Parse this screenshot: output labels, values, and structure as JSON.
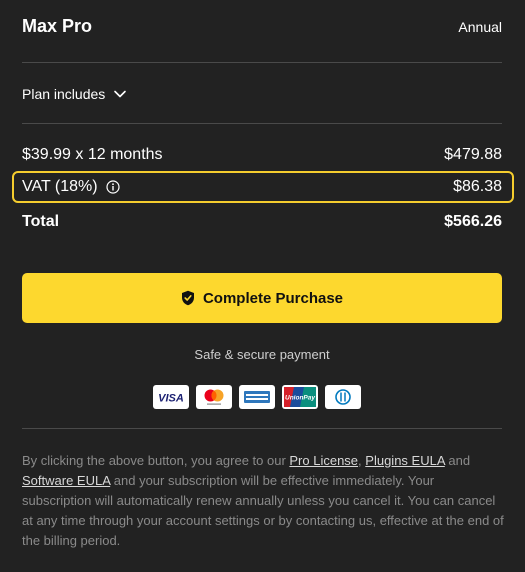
{
  "plan": {
    "name": "Max Pro",
    "billing_period": "Annual"
  },
  "plan_includes": {
    "label": "Plan includes"
  },
  "pricing": {
    "line_item_label": "$39.99 x 12 months",
    "line_item_value": "$479.88",
    "vat_label": "VAT (18%)",
    "vat_value": "$86.38",
    "total_label": "Total",
    "total_value": "$566.26"
  },
  "cta": {
    "label": "Complete Purchase"
  },
  "secure_text": "Safe & secure payment",
  "payment_methods": [
    {
      "name": "Visa",
      "label": "VISA",
      "color": "#1a1f71"
    },
    {
      "name": "Mastercard",
      "color": "#eb001b"
    },
    {
      "name": "American Express",
      "color": "#2e77bc"
    },
    {
      "name": "UnionPay",
      "label": "UnionPay",
      "color": "#d6202a"
    },
    {
      "name": "Diners Club",
      "color": "#0079be"
    }
  ],
  "legal": {
    "text_1": "By clicking the above button, you agree to our ",
    "link_pro_license": "Pro License",
    "text_2": ", ",
    "link_plugins_eula": "Plugins EULA",
    "text_3": " and ",
    "link_software_eula": "Software EULA",
    "text_4": " and your subscription will be effective immediately. Your subscription will automatically renew annually unless you cancel it. You can cancel at any time through your account settings or by contacting us, effective at the end of the billing period."
  },
  "colors": {
    "background": "#222222",
    "accent": "#fdd82e",
    "divider": "#4a4a4a"
  }
}
